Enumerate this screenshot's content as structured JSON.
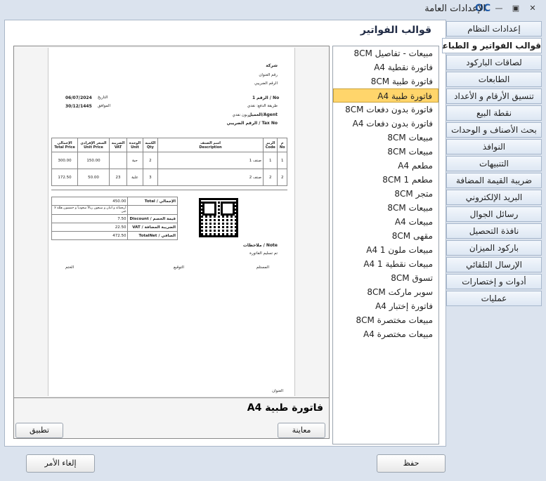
{
  "window": {
    "title": "الإعدادات العامة",
    "logo": "OC"
  },
  "main": {
    "heading": "قوالب الفواتير"
  },
  "preview": {
    "company": "شركة",
    "address": "رقم العنوان",
    "taxnum": "الرقم الضريبي",
    "date_label": "التاريخ",
    "date_value": "06/07/2024",
    "hijri_label": "الموافق",
    "hijri_value": "30/12/1445",
    "no_label": "الرقم / No",
    "no_value": "1",
    "payment_label": "طريقة الدفع: نقدي",
    "agent_label": "العميل/Agent",
    "agent_value": "زبون نقدي",
    "taxno_label": "الرقم الضريبي / Tax No",
    "columns": [
      {
        "ar": "الإجمالي",
        "en": "Total Price"
      },
      {
        "ar": "السعر الإفرادي",
        "en": "Unit Price"
      },
      {
        "ar": "الضريبة",
        "en": "VAT"
      },
      {
        "ar": "الوحدة",
        "en": "Unit"
      },
      {
        "ar": "الكمية",
        "en": "Qty"
      },
      {
        "ar": "اسم الصنف",
        "en": "Description"
      },
      {
        "ar": "الرمز",
        "en": "Code"
      },
      {
        "ar": "م",
        "en": "No"
      }
    ],
    "rows": [
      {
        "total": "300.00",
        "unit_price": "150.00",
        "vat": "",
        "unit": "حبة",
        "qty": "2",
        "desc": "صنف 1",
        "code": "1",
        "no": "1"
      },
      {
        "total": "172.50",
        "unit_price": "50.00",
        "vat": "23",
        "unit": "علبة",
        "qty": "3",
        "desc": "صنف 2",
        "code": "2",
        "no": "2"
      }
    ],
    "totals": [
      {
        "label": "الإجمالي / Total",
        "value": "450.00"
      },
      {
        "label": "",
        "value": "أربعمائة و اثنان و سبعون ريالاً سعودياً و خمسون هللة لا غير."
      },
      {
        "label": "قيمة الخصم / Discount",
        "value": "7.50"
      },
      {
        "label": "الضريبة المضافة / VAT",
        "value": "22.50"
      },
      {
        "label": "الصافي / TotalNet",
        "value": "472.50"
      }
    ],
    "note_label": "ملاحظات / Note",
    "note_text": "تم تسليم الفاتورة",
    "sign_receiver": "المستلم",
    "sign_signature": "التوقيع",
    "sign_stamp": "الختم",
    "footer_address": "العنوان",
    "template_name": "فاتورة طبية A4"
  },
  "buttons": {
    "preview": "معاينة",
    "apply": "تطبيق",
    "save": "حفظ",
    "cancel": "إلغاء الأمر"
  },
  "templates": [
    "مبيعات - تفاصيل 8CM",
    "فاتورة نقطية A4",
    "فاتورة طبية 8CM",
    "فاتورة طبية A4",
    "فاتورة بدون دفعات 8CM",
    "فاتورة بدون دفعات A4",
    "مبيعات 8CM",
    "مبيعات 8CM",
    "مطعم A4",
    "مطعم 1 8CM",
    "متجر 8CM",
    "مبيعات 8CM",
    "مبيعات A4",
    "مقهى 8CM",
    "مبيعات ملون 1 A4",
    "مبيعات نقطية 1 A4",
    "تسوق 8CM",
    "سوبر ماركت 8CM",
    "فاتورة إختبار A4",
    "مبيعات مختصرة 8CM",
    "مبيعات مختصرة A4"
  ],
  "selected_template_index": 3,
  "tabs": [
    "إعدادات النظام",
    "قوالب الفواتير و الطباعة",
    "لصاقات الباركود",
    "الطابعات",
    "تنسيق الأرقام و الأعداد",
    "نقطة البيع",
    "بحث الأصناف و الوحدات",
    "النوافذ",
    "التنبيهات",
    "ضريبة القيمة المضافة",
    "البريد الإلكتروني",
    "رسائل الجوال",
    "نافذة التحصيل",
    "باركود الميزان",
    "الإرسال التلقائي",
    "أدوات و إختصارات",
    "عمليات"
  ],
  "active_tab_index": 1
}
